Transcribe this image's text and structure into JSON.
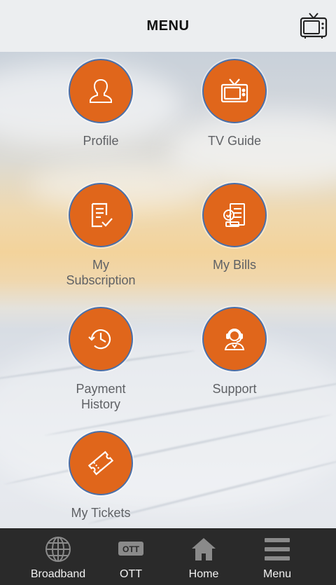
{
  "header": {
    "title": "MENU",
    "tv_icon": "tv-icon"
  },
  "menu_items": [
    {
      "label": "Profile",
      "icon": "person-icon"
    },
    {
      "label": "TV Guide",
      "icon": "tv-icon"
    },
    {
      "label": "My\nSubscription",
      "icon": "subscription-icon"
    },
    {
      "label": "My Bills",
      "icon": "bills-icon"
    },
    {
      "label": "Payment\nHistory",
      "icon": "history-icon"
    },
    {
      "label": "Support",
      "icon": "support-icon"
    },
    {
      "label": "My Tickets",
      "icon": "ticket-icon"
    }
  ],
  "bottom_nav": [
    {
      "label": "Broadband",
      "icon": "globe-icon"
    },
    {
      "label": "OTT",
      "icon": "ott-icon"
    },
    {
      "label": "Home",
      "icon": "home-icon"
    },
    {
      "label": "Menu",
      "icon": "hamburger-icon"
    }
  ],
  "colors": {
    "accent": "#e0661b",
    "ring": "#4a6fa8",
    "nav_bg": "#2a2a2a",
    "header_bg": "#eceef0"
  }
}
